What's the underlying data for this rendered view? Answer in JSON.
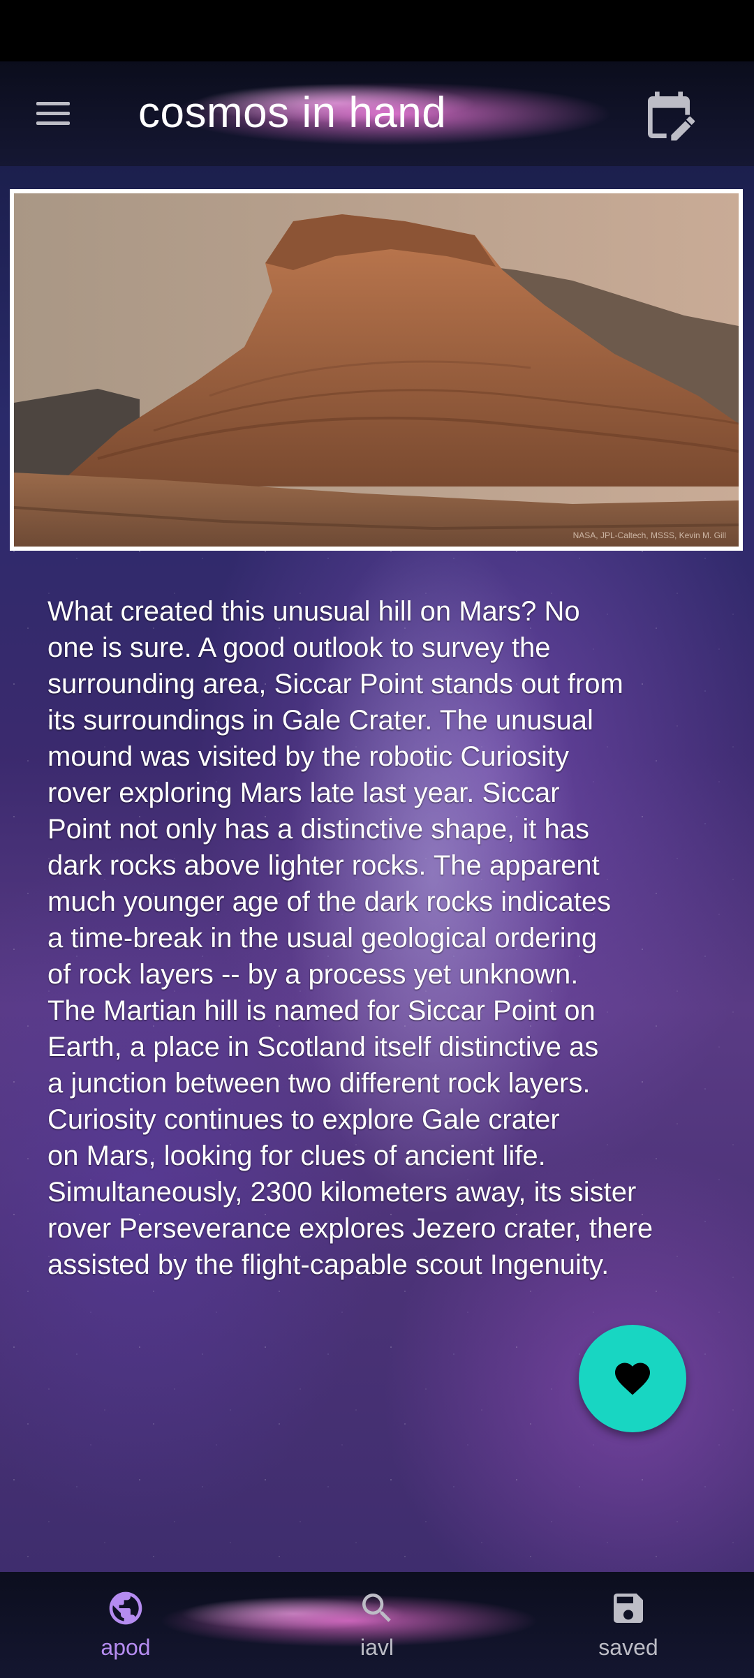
{
  "app": {
    "title": "cosmos in hand"
  },
  "header": {
    "menu_icon": "menu-icon",
    "calendar_icon": "calendar-edit-icon"
  },
  "image": {
    "credit": "NASA, JPL-Caltech, MSSS, Kevin M. Gill"
  },
  "description": "What created this unusual hill on Mars? No\none is sure.  A good outlook to survey the\nsurrounding area, Siccar Point stands out from\nits surroundings in Gale Crater. The unusual\nmound was visited by the robotic Curiosity\nrover exploring Mars late last year. Siccar\nPoint not only has a distinctive shape, it has\ndark rocks above lighter rocks.  The apparent\nmuch younger age of the dark rocks indicates\na time-break in the usual geological ordering\nof rock layers -- by a process yet unknown.\nThe Martian hill is named for Siccar Point on\nEarth, a place in Scotland itself distinctive as\na junction between two different rock layers.\nCuriosity continues to explore Gale crater\non Mars, looking for clues of ancient life.\nSimultaneously, 2300 kilometers away, its sister\nrover Perseverance explores Jezero crater, there\nassisted by the flight-capable scout Ingenuity.",
  "fab": {
    "icon": "heart-icon"
  },
  "bottom_nav": {
    "items": [
      {
        "label": "apod",
        "icon": "globe-icon",
        "active": true
      },
      {
        "label": "iavl",
        "icon": "search-icon",
        "active": false
      },
      {
        "label": "saved",
        "icon": "save-icon",
        "active": false
      }
    ]
  },
  "colors": {
    "accent": "#18d6c2",
    "nav_active": "#b58cf0",
    "nav_inactive": "#bdbdc6"
  }
}
